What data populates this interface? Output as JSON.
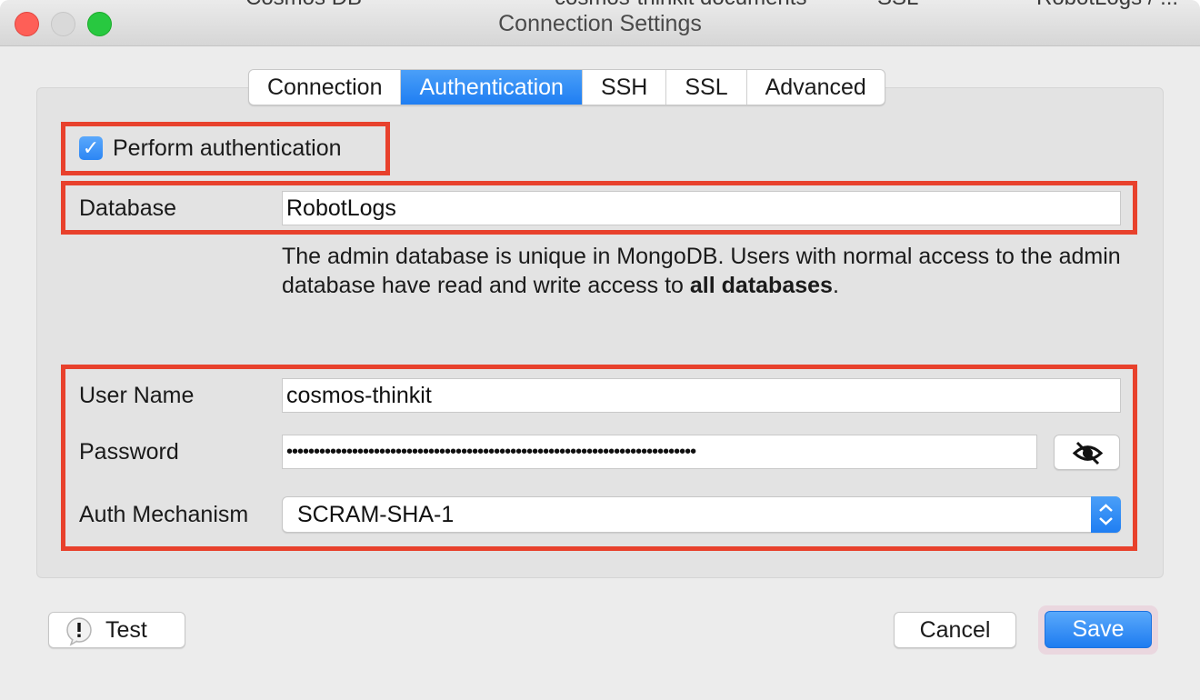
{
  "window": {
    "title": "Connection Settings",
    "background_tabs": [
      "Cosmos DB",
      "cosmos-thinkit documents",
      "SSL",
      "RobotLogs / ..."
    ]
  },
  "tabs": [
    {
      "label": "Connection",
      "active": false
    },
    {
      "label": "Authentication",
      "active": true
    },
    {
      "label": "SSH",
      "active": false
    },
    {
      "label": "SSL",
      "active": false
    },
    {
      "label": "Advanced",
      "active": false
    }
  ],
  "auth": {
    "perform_label": "Perform authentication",
    "perform_checked": true,
    "database_label": "Database",
    "database_value": "RobotLogs",
    "help_text_1": "The admin database is unique in MongoDB. Users with normal access to the admin database have read and write access to",
    "help_text_bold": "all databases",
    "help_text_end": ".",
    "username_label": "User Name",
    "username_value": "cosmos-thinkit",
    "password_label": "Password",
    "password_value": "•••••••••••••••••••••••••••••••••••••••••••••••••••••••••••••••••••••••••••",
    "mechanism_label": "Auth Mechanism",
    "mechanism_value": "SCRAM-SHA-1"
  },
  "buttons": {
    "test": "Test",
    "cancel": "Cancel",
    "save": "Save"
  },
  "colors": {
    "highlight": "#e8412c",
    "accent": "#1f7ef2"
  },
  "icons": {
    "eye": "eye-slash-icon",
    "test": "warning-bubble-icon",
    "select": "chevron-updown-icon",
    "check": "checkmark-icon"
  }
}
